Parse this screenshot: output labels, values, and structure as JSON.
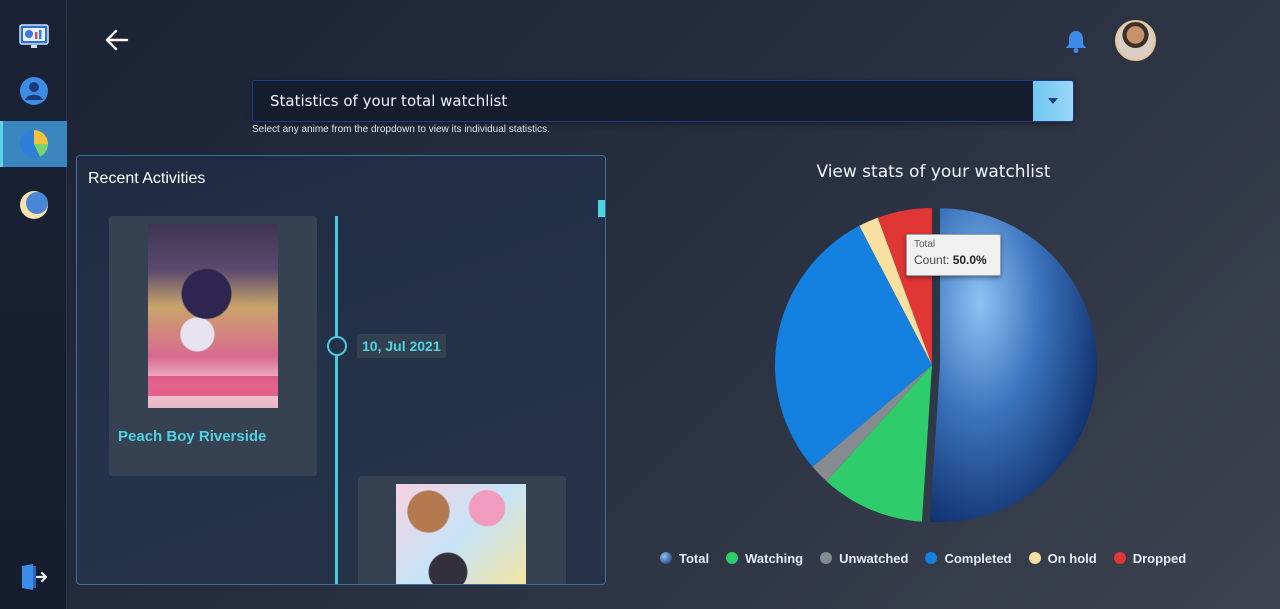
{
  "header": {
    "back_icon": "arrow-left-icon",
    "notification_icon": "bell-icon",
    "avatar": "user-avatar"
  },
  "sidebar": {
    "items": [
      {
        "name": "dashboard",
        "icon": "monitor-chart-icon",
        "active": false
      },
      {
        "name": "profile",
        "icon": "user-icon",
        "active": false
      },
      {
        "name": "statistics",
        "icon": "pie-chart-icon",
        "active": true
      },
      {
        "name": "theme",
        "icon": "moon-icon",
        "active": false
      }
    ],
    "logout_icon": "logout-icon"
  },
  "dropdown": {
    "selected": "Statistics of your total watchlist",
    "hint": "Select any anime from the dropdown to view its individual statistics."
  },
  "activities": {
    "title": "Recent Activities",
    "items": [
      {
        "date": "10, Jul 2021",
        "title": "Peach Boy Riverside"
      }
    ]
  },
  "chart_data": {
    "type": "pie",
    "title": "View stats of your watchlist",
    "categories": [
      "Total",
      "Watching",
      "Unwatched",
      "Completed",
      "On hold",
      "Dropped"
    ],
    "values": [
      50.0,
      10.5,
      2.0,
      28.0,
      2.0,
      5.5
    ],
    "colors": [
      "#2b5ea8",
      "#2ecc6b",
      "#858b91",
      "#1480e0",
      "#f7e0a0",
      "#e03636"
    ],
    "legend_position": "bottom",
    "tooltip": {
      "label": "Total",
      "prefix": "Count: ",
      "value": "50.0%"
    }
  }
}
